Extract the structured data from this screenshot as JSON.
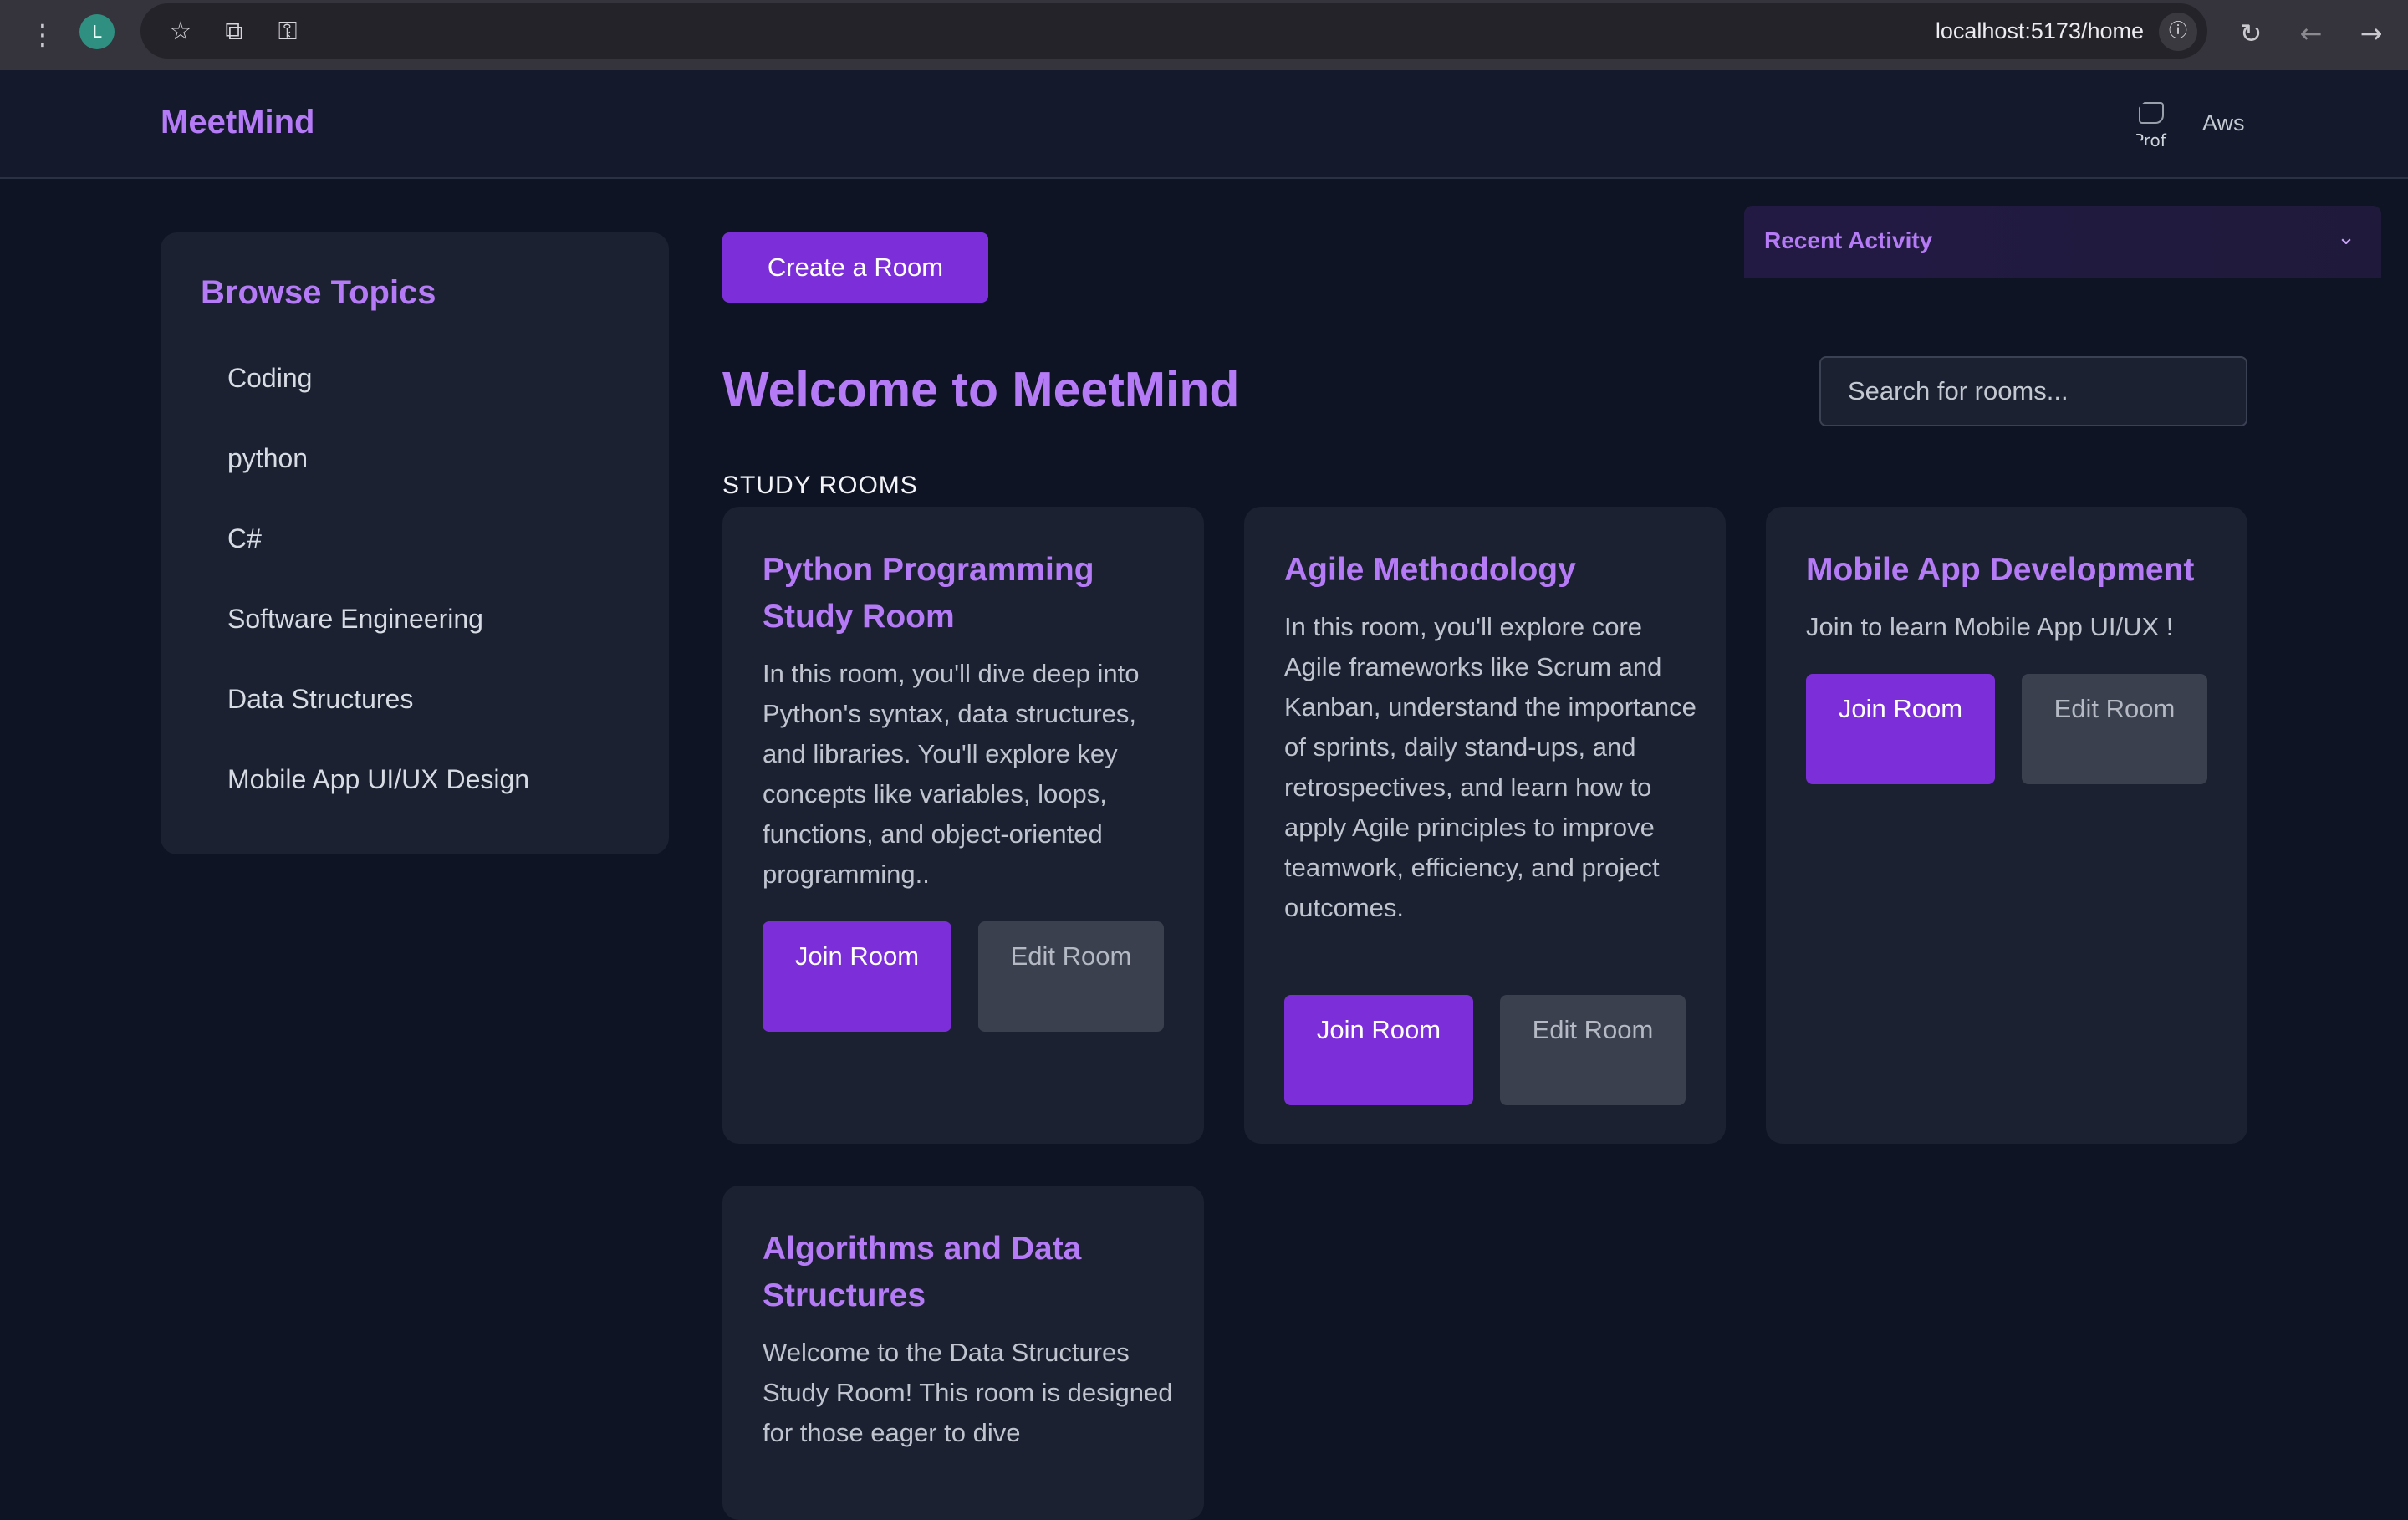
{
  "browser": {
    "profile_initial": "L",
    "url": "localhost:5173/home"
  },
  "header": {
    "brand": "MeetMind",
    "avatar_alt": "Prof",
    "username": "Aws"
  },
  "sidebar": {
    "title": "Browse Topics",
    "topics": [
      "Coding",
      "python",
      "C#",
      "Software Engineering",
      "Data Structures",
      "Mobile App UI/UX Design"
    ]
  },
  "main": {
    "create_room_label": "Create a Room",
    "welcome_title": "Welcome to MeetMind",
    "section_label": "STUDY ROOMS",
    "search_placeholder": "Search for rooms..."
  },
  "recent_activity": {
    "title": "Recent Activity"
  },
  "rooms": [
    {
      "title": "Python Programming Study Room",
      "description": "In this room, you'll dive deep into Python's syntax, data structures, and libraries. You'll explore key concepts like variables, loops, functions, and object-oriented programming..",
      "join_label": "Join Room",
      "edit_label": "Edit Room"
    },
    {
      "title": "Agile Methodology",
      "description": "In this room, you'll explore core Agile frameworks like Scrum and Kanban, understand the importance of sprints, daily stand-ups, and retrospectives, and learn how to apply Agile principles to improve teamwork, efficiency, and project outcomes.",
      "join_label": "Join Room",
      "edit_label": "Edit Room"
    },
    {
      "title": "Mobile App Development",
      "description": "Join to learn Mobile App UI/UX !",
      "join_label": "Join Room",
      "edit_label": "Edit Room"
    },
    {
      "title": "Algorithms and Data Structures",
      "description": "Welcome to the Data Structures Study Room! This room is designed for those eager to dive"
    }
  ],
  "colors": {
    "accent": "#b57af5",
    "button_primary": "#7c2fd8",
    "background": "#0f1424",
    "card": "#1b2131"
  }
}
